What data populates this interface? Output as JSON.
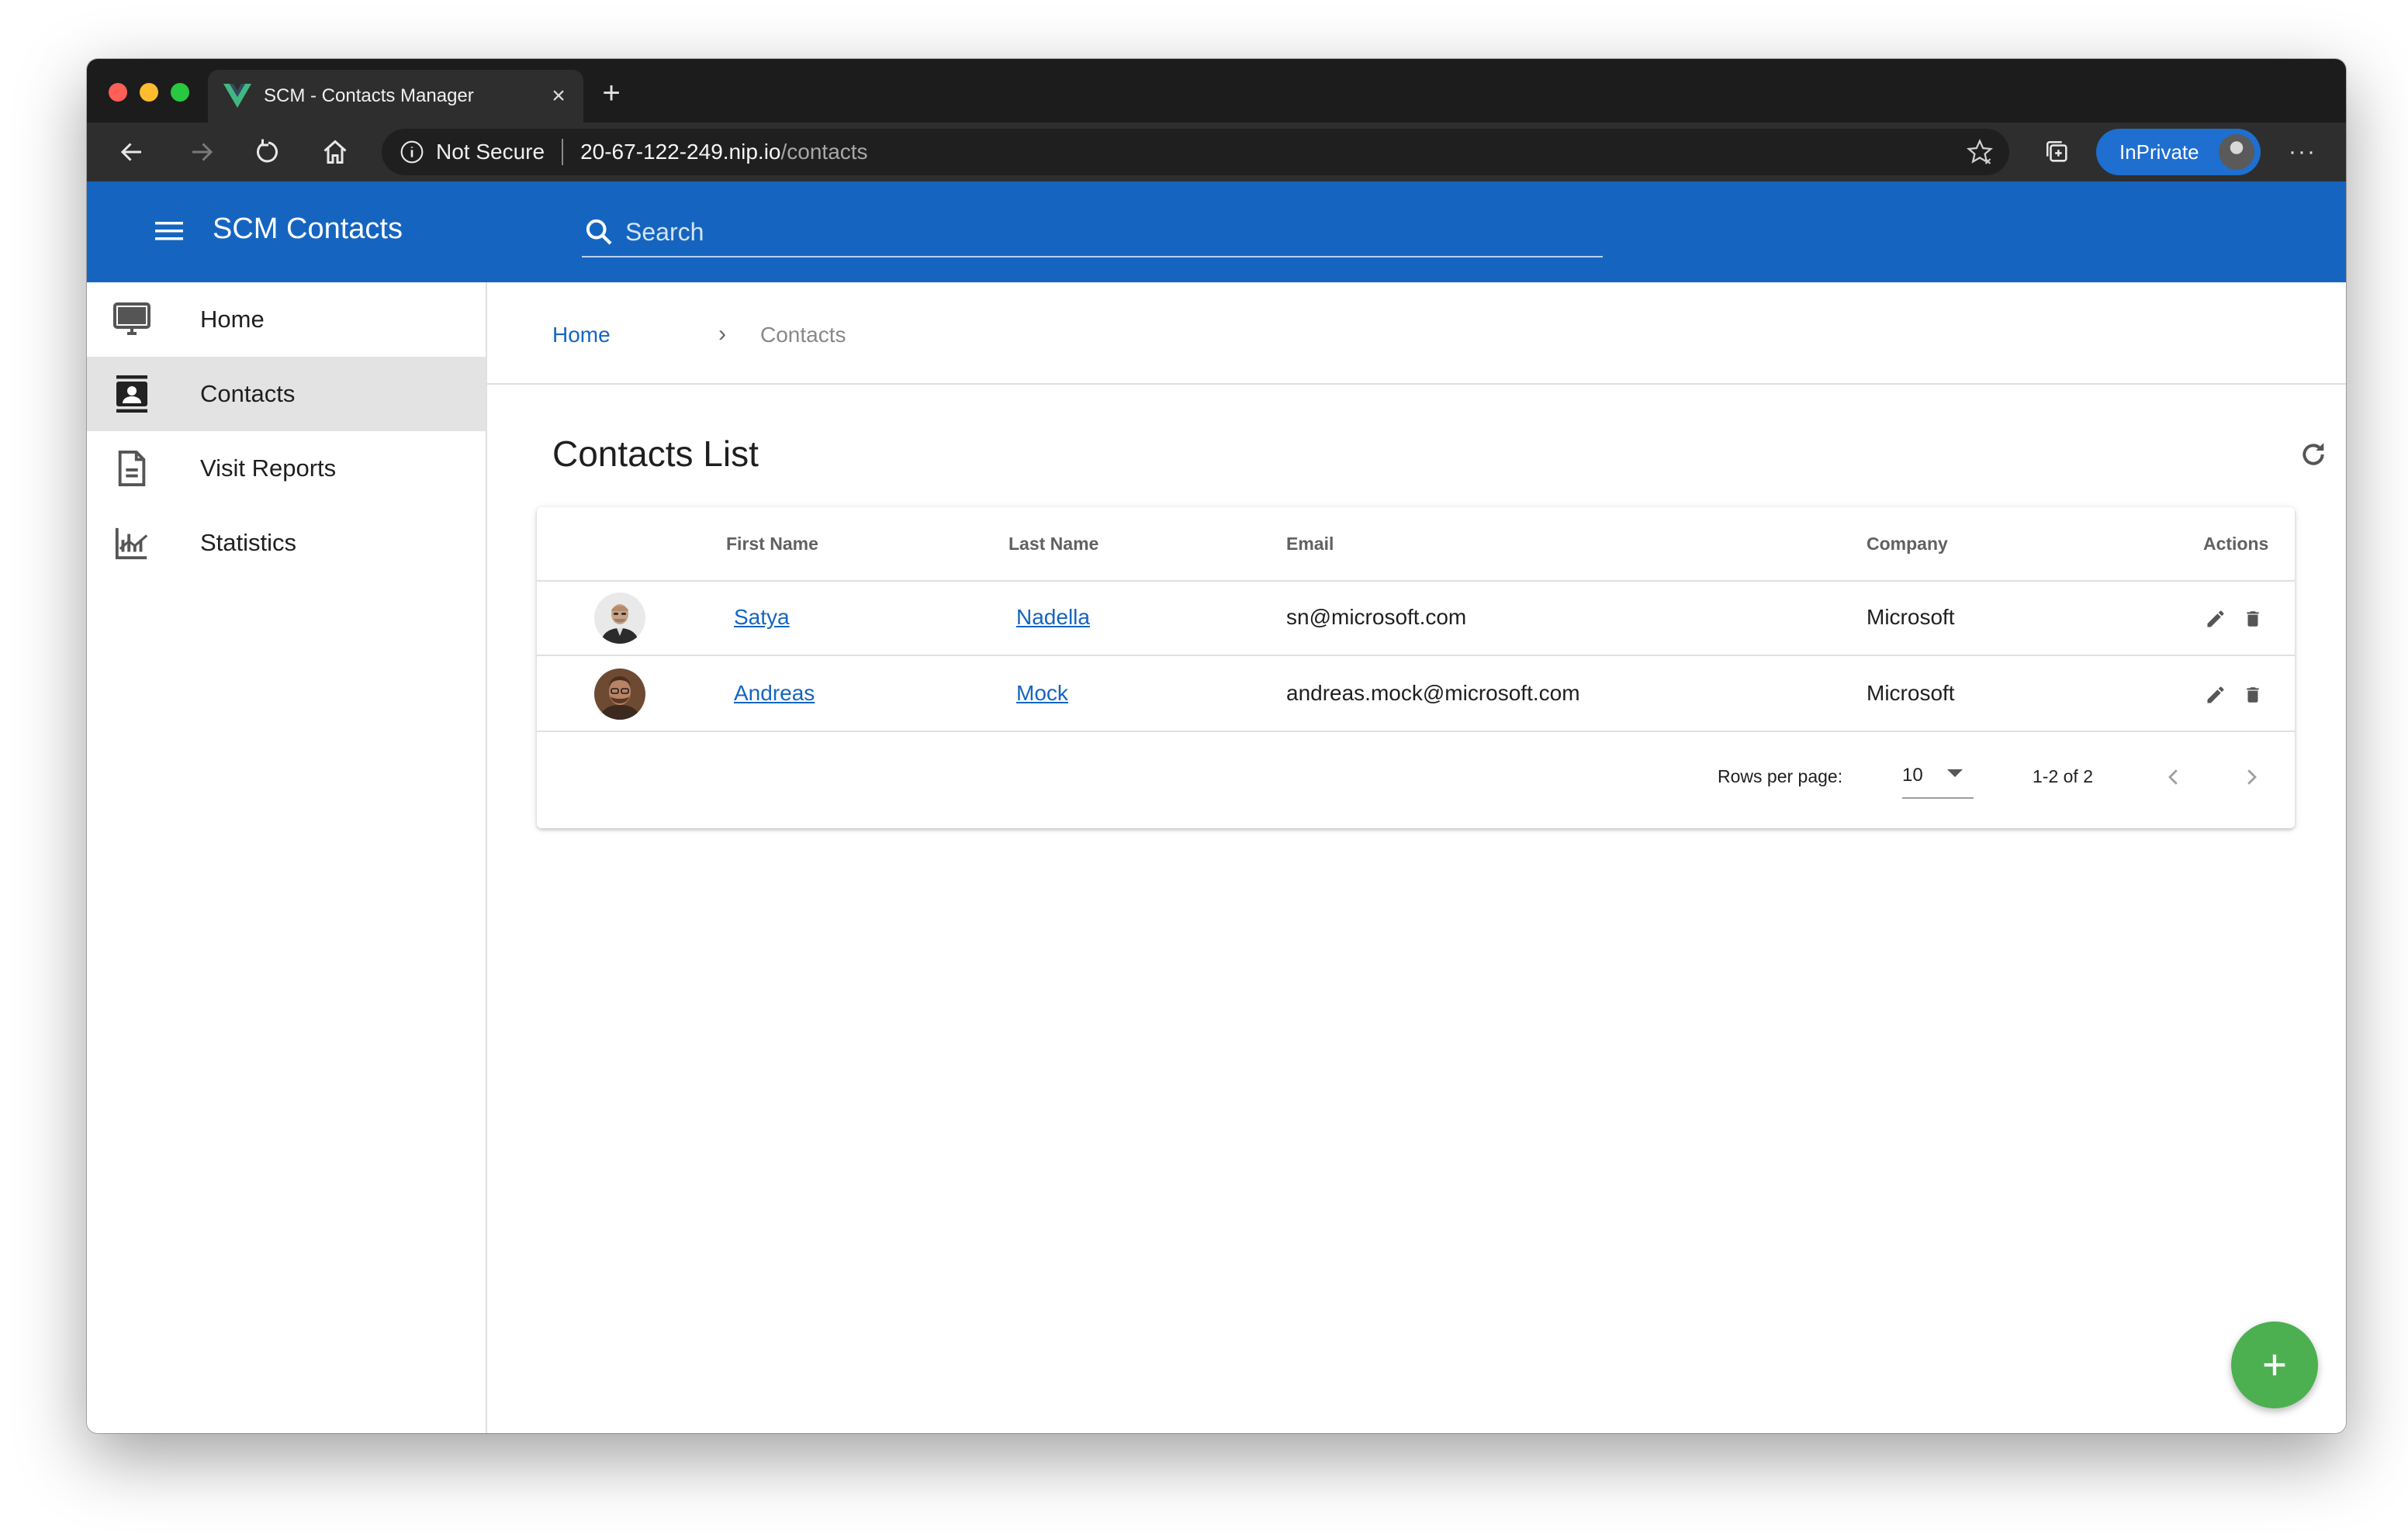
{
  "browser": {
    "tab_title": "SCM - Contacts Manager",
    "address": {
      "security_label": "Not Secure",
      "host": "20-67-122-249.nip.io",
      "path": "/contacts"
    },
    "inprivate_label": "InPrivate"
  },
  "app": {
    "title": "SCM Contacts",
    "search_placeholder": "Search"
  },
  "sidebar": {
    "items": [
      {
        "label": "Home",
        "icon": "monitor-icon",
        "active": false
      },
      {
        "label": "Contacts",
        "icon": "contacts-icon",
        "active": true
      },
      {
        "label": "Visit Reports",
        "icon": "document-icon",
        "active": false
      },
      {
        "label": "Statistics",
        "icon": "chart-icon",
        "active": false
      }
    ]
  },
  "breadcrumb": {
    "home": "Home",
    "separator": "›",
    "current": "Contacts"
  },
  "page": {
    "title": "Contacts List"
  },
  "table": {
    "headers": {
      "first_name": "First Name",
      "last_name": "Last Name",
      "email": "Email",
      "company": "Company",
      "actions": "Actions"
    },
    "rows": [
      {
        "first_name": "Satya",
        "last_name": "Nadella",
        "email": "sn@microsoft.com",
        "company": "Microsoft"
      },
      {
        "first_name": "Andreas",
        "last_name": "Mock",
        "email": "andreas.mock@microsoft.com",
        "company": "Microsoft"
      }
    ]
  },
  "pagination": {
    "rows_per_page_label": "Rows per page:",
    "rows_per_page_value": "10",
    "range": "1-2 of 2"
  },
  "colors": {
    "app_bar": "#1565c0",
    "fab": "#4caf50",
    "active_nav": "#e3e3e3"
  }
}
